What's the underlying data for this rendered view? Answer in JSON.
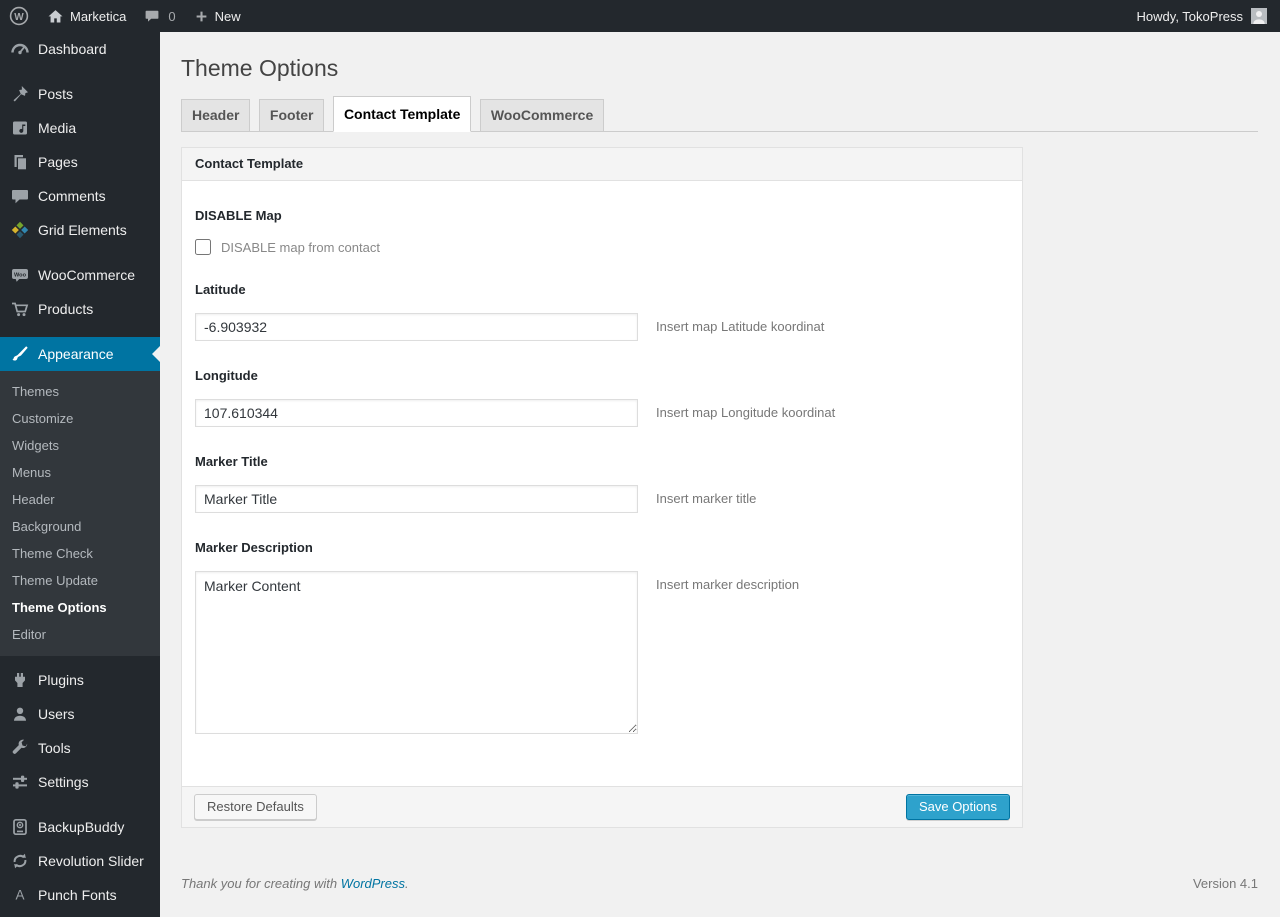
{
  "admin_bar": {
    "site_name": "Marketica",
    "comment_count": "0",
    "new_label": "New",
    "howdy": "Howdy, TokoPress"
  },
  "sidebar": {
    "items": [
      {
        "label": "Dashboard",
        "icon": "dashboard-icon"
      },
      {
        "label": "Posts",
        "icon": "pin-icon"
      },
      {
        "label": "Media",
        "icon": "media-icon"
      },
      {
        "label": "Pages",
        "icon": "pages-icon"
      },
      {
        "label": "Comments",
        "icon": "comments-icon"
      },
      {
        "label": "Grid Elements",
        "icon": "grid-elements-icon"
      },
      {
        "label": "WooCommerce",
        "icon": "woocommerce-badge-icon"
      },
      {
        "label": "Products",
        "icon": "cart-icon"
      },
      {
        "label": "Appearance",
        "icon": "paintbrush-icon",
        "active": true
      },
      {
        "label": "Plugins",
        "icon": "plugin-icon"
      },
      {
        "label": "Users",
        "icon": "user-icon"
      },
      {
        "label": "Tools",
        "icon": "wrench-icon"
      },
      {
        "label": "Settings",
        "icon": "sliders-icon"
      },
      {
        "label": "BackupBuddy",
        "icon": "backup-device-icon"
      },
      {
        "label": "Revolution Slider",
        "icon": "refresh-arrows-icon"
      },
      {
        "label": "Punch Fonts",
        "icon": "letter-a-icon"
      }
    ],
    "appearance_submenu": [
      {
        "label": "Themes"
      },
      {
        "label": "Customize"
      },
      {
        "label": "Widgets"
      },
      {
        "label": "Menus"
      },
      {
        "label": "Header"
      },
      {
        "label": "Background"
      },
      {
        "label": "Theme Check"
      },
      {
        "label": "Theme Update"
      },
      {
        "label": "Theme Options",
        "current": true
      },
      {
        "label": "Editor"
      }
    ]
  },
  "page": {
    "title": "Theme Options"
  },
  "tabs": [
    {
      "label": "Header",
      "active": false
    },
    {
      "label": "Footer",
      "active": false
    },
    {
      "label": "Contact Template",
      "active": true
    },
    {
      "label": "WooCommerce",
      "active": false
    }
  ],
  "panel": {
    "header": "Contact Template",
    "fields": {
      "disable_map": {
        "label": "DISABLE Map",
        "checkbox_label": "DISABLE map from contact",
        "checked": false
      },
      "latitude": {
        "label": "Latitude",
        "value": "-6.903932",
        "help": "Insert map Latitude koordinat"
      },
      "longitude": {
        "label": "Longitude",
        "value": "107.610344",
        "help": "Insert map Longitude koordinat"
      },
      "marker_title": {
        "label": "Marker Title",
        "value": "Marker Title",
        "help": "Insert marker title"
      },
      "marker_description": {
        "label": "Marker Description",
        "value": "Marker Content",
        "help": "Insert marker description"
      }
    },
    "footer": {
      "restore_label": "Restore Defaults",
      "save_label": "Save Options"
    }
  },
  "page_footer": {
    "thanks_text": "Thank you for creating with",
    "link_label": "WordPress",
    "period": ".",
    "version": "Version 4.1"
  },
  "icons": {
    "logo": "wordpress-logo-icon",
    "home": "home-icon",
    "comments": "comment-bubble-icon",
    "new": "plus-icon",
    "avatar": "avatar-mystery-person"
  },
  "colors": {
    "accent": "#0074a2",
    "primary_button": "#2ea2cc",
    "admin_bar_bg": "#23282d",
    "menu_bg": "#23282d",
    "submenu_bg": "#32373c",
    "body_bg": "#f1f1f1",
    "panel_bg": "#ffffff"
  }
}
